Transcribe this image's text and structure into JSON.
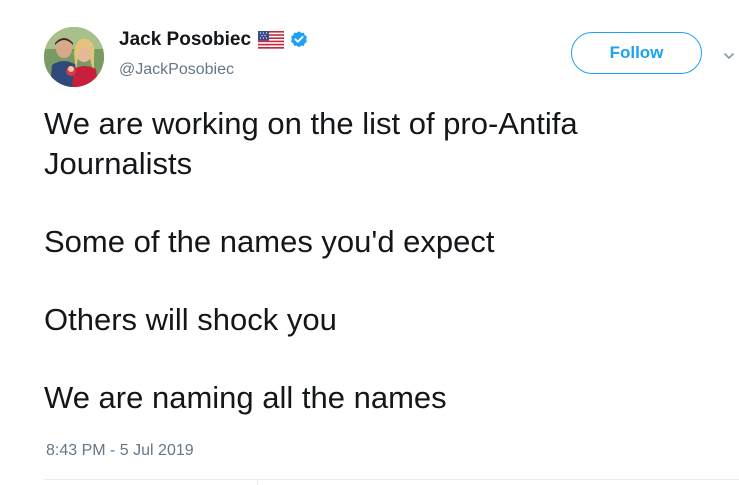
{
  "author": {
    "name": "Jack Posobiec",
    "handle": "@JackPosobiec",
    "flag_icon": "us-flag-icon",
    "verified_icon": "verified-badge-icon",
    "verified_color": "#1da1f2"
  },
  "follow_button": {
    "label": "Follow",
    "color": "#1da1f2"
  },
  "menu": {
    "icon": "chevron-down-icon"
  },
  "tweet": {
    "lines": [
      "We are working on the list of pro-Antifa",
      "Journalists",
      "Some of the names you'd expect",
      "Others will shock you",
      "We are naming all the names"
    ],
    "timestamp": "8:43 PM - 5 Jul 2019"
  },
  "colors": {
    "text_primary": "#14171a",
    "text_secondary": "#657786",
    "accent": "#1da1f2",
    "divider": "#e6ecf0"
  }
}
